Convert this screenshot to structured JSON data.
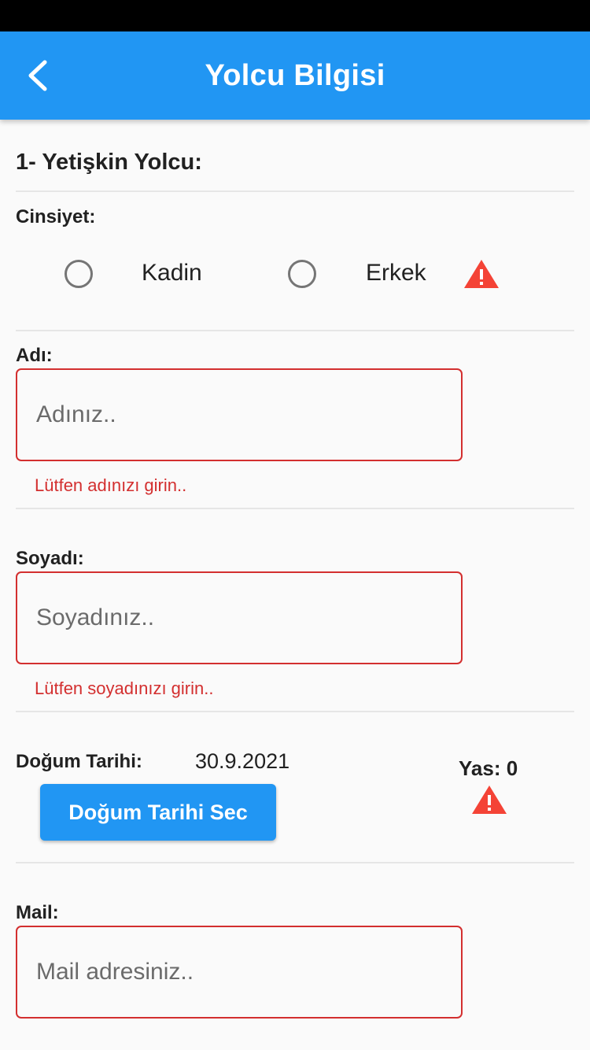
{
  "app_bar": {
    "title": "Yolcu Bilgisi",
    "back_icon": "chevron-left-icon",
    "background": "#2196f3"
  },
  "passenger": {
    "section_title": "1- Yetişkin Yolcu:"
  },
  "gender": {
    "label": "Cinsiyet:",
    "options": [
      {
        "label": "Kadin",
        "selected": false
      },
      {
        "label": "Erkek",
        "selected": false
      }
    ],
    "warning_icon": "warning-icon"
  },
  "first_name": {
    "label": "Adı:",
    "placeholder": "Adınız..",
    "value": "",
    "error": "Lütfen adınızı girin.."
  },
  "last_name": {
    "label": "Soyadı:",
    "placeholder": "Soyadınız..",
    "value": "",
    "error": "Lütfen soyadınızı girin.."
  },
  "birth_date": {
    "label": "Doğum Tarihi:",
    "value": "30.9.2021",
    "button_label": "Doğum Tarihi Sec",
    "age_label": "Yas: 0",
    "warning_icon": "warning-icon"
  },
  "mail": {
    "label": "Mail:",
    "placeholder": "Mail adresiniz..",
    "value": ""
  },
  "colors": {
    "primary": "#2196f3",
    "error": "#d32f2f",
    "warning": "#f44336"
  }
}
